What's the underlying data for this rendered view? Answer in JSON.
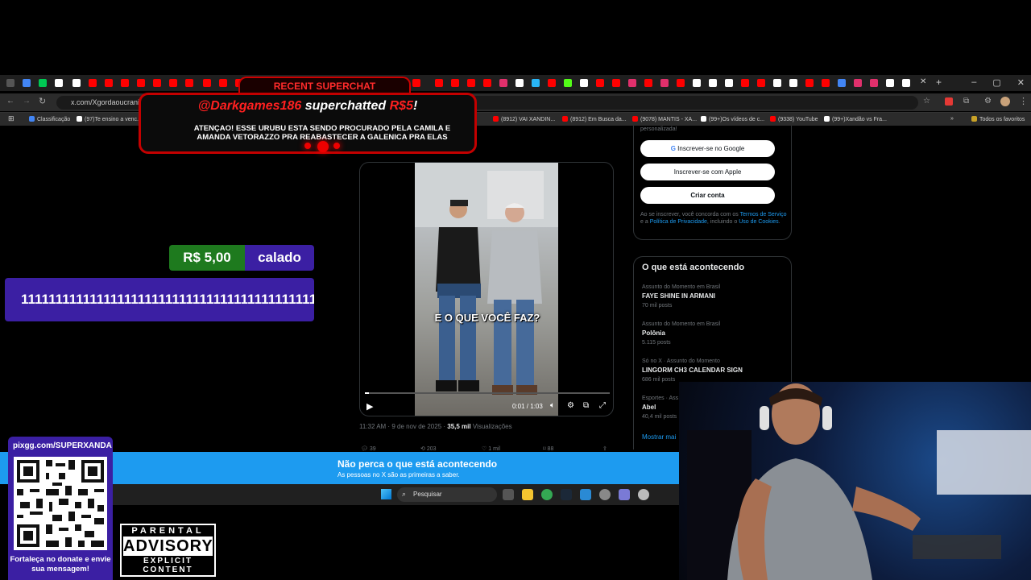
{
  "browser": {
    "url": "x.com/Xgordaoucrania/s",
    "window_controls": [
      "–",
      "▢",
      "✕"
    ],
    "new_tab": "+",
    "close_tab": "✕",
    "bookmarks": [
      "Classificação",
      "(97)Te ensino a venc...",
      "(8912) VAI XANDIN...",
      "(8912) Em Busca da...",
      "(9078) MANTIS - XA...",
      "(99+)Os vídeos de c...",
      "(9338) YouTube",
      "(99+)Xandão vs Fra..."
    ],
    "all_favorites": "Todos os favoritos",
    "colors": {
      "tabstrip": "#1f1f1f",
      "bar": "#2b2b2b"
    }
  },
  "tweet": {
    "video_caption": "E O QUE VOCÊ FAZ?",
    "time": "0:01 / 1:03",
    "progress": 0.016,
    "timestamp": "11:32 AM · 9 de nov de 2025 · ",
    "views_count": "35,5 mil",
    "views_label": " Visualizações",
    "replies": "39",
    "reposts": "203",
    "likes": "1 mil",
    "bookmarks": "88"
  },
  "sidebar": {
    "signup_text": "personalizada!",
    "google_button": "Inscrever-se no Google",
    "apple_button": "Inscrever-se com Apple",
    "create_button": "Criar conta",
    "terms_prefix": "Ao se inscrever, você concorda com os ",
    "terms_link": "Termos de Serviço",
    "terms_mid": " e a ",
    "privacy_link": "Política de Privacidade",
    "terms_mid2": ", incluindo o ",
    "cookies_link": "Uso de Cookies",
    "terms_end": ".",
    "trends_title": "O que está acontecendo",
    "trends": [
      {
        "context": "Assunto do Momento em Brasil",
        "name": "FAYE SHINE IN ARMANI",
        "posts": "70 mil posts"
      },
      {
        "context": "Assunto do Momento em Brasil",
        "name": "Polônia",
        "posts": "5.115 posts"
      },
      {
        "context": "Só no X · Assunto do Momento",
        "name": "LINGORM CH3 CALENDAR SIGN",
        "posts": "686 mil posts"
      },
      {
        "context": "Esportes · Ass",
        "name": "Abel",
        "posts": "40,4 mil posts"
      }
    ],
    "show_more": "Mostrar mai"
  },
  "banner": {
    "title": "Não perca o que está acontecendo",
    "subtitle": "As pessoas no X são as primeiras a saber."
  },
  "taskbar": {
    "search_placeholder": "Pesquisar"
  },
  "superchat": {
    "header": "RECENT SUPERCHAT",
    "user": "@Darkgames186",
    "verb": " superchatted ",
    "amount": "R$5",
    "exclaim": "!",
    "message": "ATENÇAO! ESSE URUBU ESTA SENDO PROCURADO PELA CAMILA E AMANDA VETORAZZO PRA REABASTECER A GALENICA PRA ELAS"
  },
  "donation": {
    "amount": "R$ 5,00",
    "name": "calado",
    "message": "1111111111111111111111111111111111111111111111111111"
  },
  "pix": {
    "url": "pixgg.com/SUPERXANDA",
    "cta": "Fortaleça no donate e envie sua mensagem!"
  },
  "advisory": {
    "line1": "PARENTAL",
    "line2": "ADVISORY",
    "line3": "EXPLICIT CONTENT"
  }
}
